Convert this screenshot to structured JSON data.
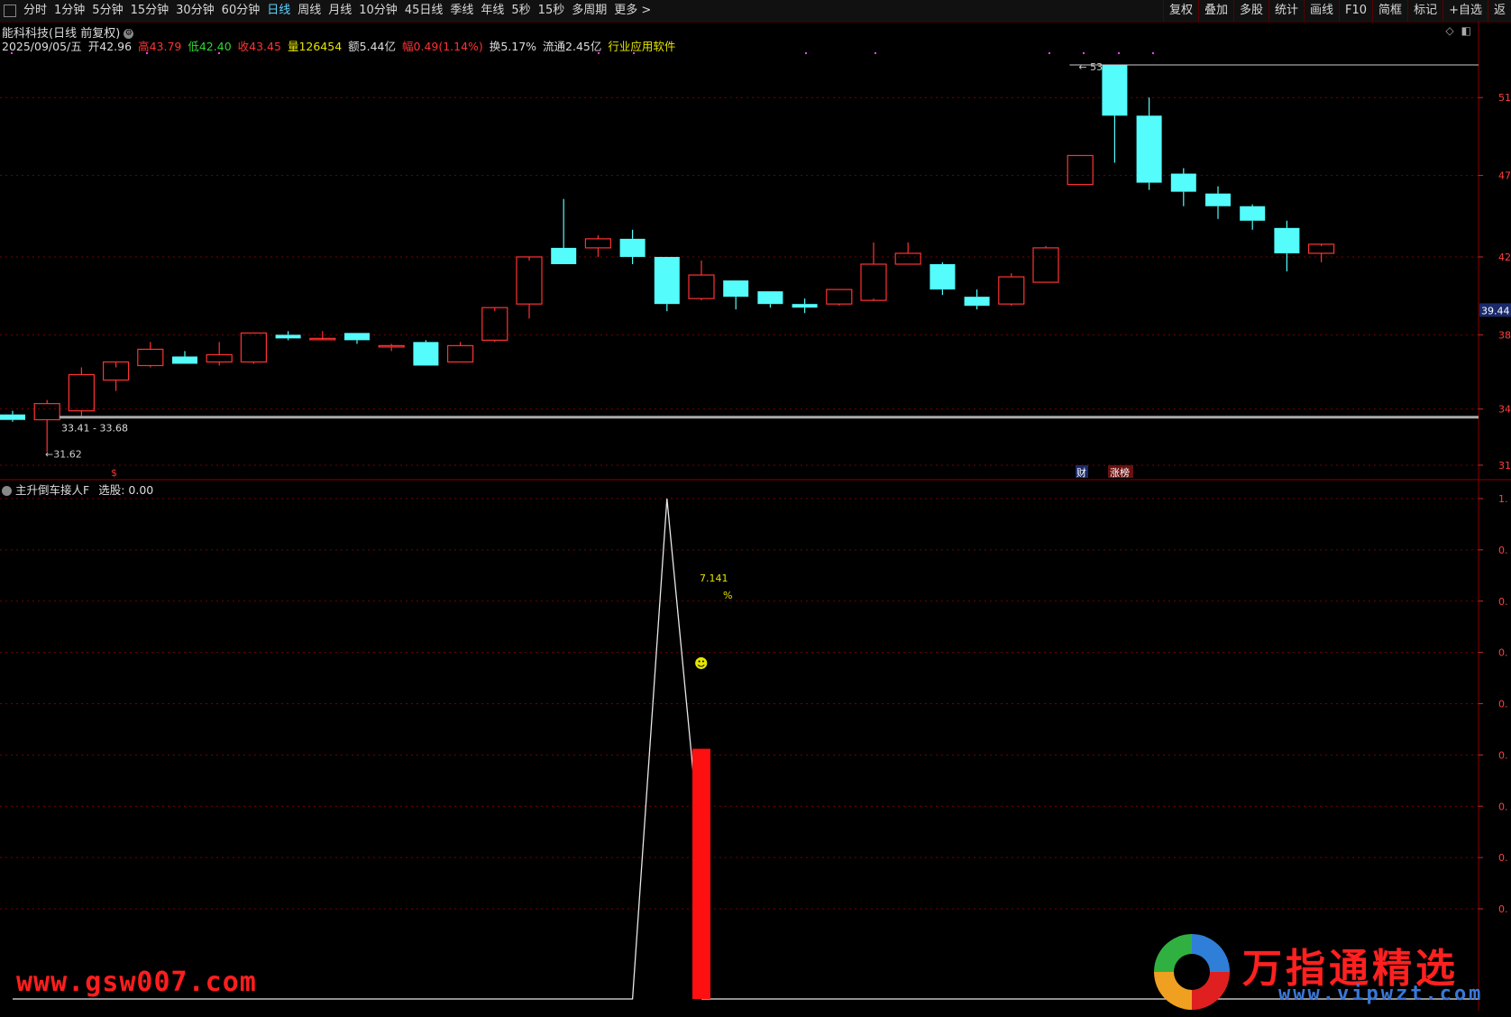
{
  "toolbar": {
    "periods": [
      "分时",
      "1分钟",
      "5分钟",
      "15分钟",
      "30分钟",
      "60分钟",
      "日线",
      "周线",
      "月线",
      "10分钟",
      "45日线",
      "季线",
      "年线",
      "5秒",
      "15秒",
      "多周期",
      "更多 >"
    ],
    "active_index": 6,
    "right_buttons": [
      "复权",
      "叠加",
      "多股",
      "统计",
      "画线",
      "F10",
      "简框",
      "标记",
      "+自选",
      "返"
    ]
  },
  "title": {
    "text": "能科科技(日线 前复权)"
  },
  "info": {
    "date": "2025/09/05/五",
    "open_label": "开",
    "open": "42.96",
    "high_label": "高",
    "high": "43.79",
    "low_label": "低",
    "low": "42.40",
    "close_label": "收",
    "close": "43.45",
    "vol_label": "量",
    "vol": "126454",
    "amount_label": "额",
    "amount": "5.44亿",
    "change_label": "幅",
    "change": "0.49(1.14%)",
    "turnover_label": "换",
    "turnover": "5.17%",
    "float_label": "流通",
    "float": "2.45亿",
    "industry": "行业应用软件"
  },
  "colors": {
    "up": "#ff3232",
    "down": "#54fcfc",
    "grid": "#7a0000",
    "price_tag_bg": "#1a2a6a"
  },
  "chart_data": [
    {
      "type": "candlestick",
      "axis_ticks": [
        "51.",
        "47.",
        "42.",
        "38.",
        "34.",
        "31."
      ],
      "current_price_tag": "39.44",
      "max_label": "53.",
      "min_label": "31.62",
      "range_label": "33.41 - 33.68",
      "marker_labels": [
        "$",
        "财",
        "涨榜"
      ],
      "candles": [
        {
          "o": 33.7,
          "h": 33.9,
          "l": 33.3,
          "c": 33.4
        },
        {
          "o": 33.41,
          "h": 34.5,
          "l": 31.62,
          "c": 34.3
        },
        {
          "o": 33.9,
          "h": 36.3,
          "l": 33.6,
          "c": 35.9
        },
        {
          "o": 35.6,
          "h": 36.3,
          "l": 35.0,
          "c": 36.6
        },
        {
          "o": 36.4,
          "h": 37.7,
          "l": 36.3,
          "c": 37.3
        },
        {
          "o": 36.9,
          "h": 37.2,
          "l": 36.5,
          "c": 36.5
        },
        {
          "o": 36.6,
          "h": 37.7,
          "l": 36.4,
          "c": 37.0
        },
        {
          "o": 36.6,
          "h": 38.2,
          "l": 36.5,
          "c": 38.2
        },
        {
          "o": 38.1,
          "h": 38.3,
          "l": 37.8,
          "c": 37.9
        },
        {
          "o": 37.9,
          "h": 38.3,
          "l": 37.9,
          "c": 37.9
        },
        {
          "o": 38.2,
          "h": 38.2,
          "l": 37.6,
          "c": 37.8
        },
        {
          "o": 37.5,
          "h": 37.6,
          "l": 37.2,
          "c": 37.5
        },
        {
          "o": 37.7,
          "h": 37.8,
          "l": 36.5,
          "c": 36.4
        },
        {
          "o": 36.6,
          "h": 37.7,
          "l": 36.6,
          "c": 37.5
        },
        {
          "o": 37.8,
          "h": 39.4,
          "l": 37.7,
          "c": 39.6
        },
        {
          "o": 39.8,
          "h": 42.2,
          "l": 39.0,
          "c": 42.4
        },
        {
          "o": 42.9,
          "h": 45.6,
          "l": 42.0,
          "c": 42.0
        },
        {
          "o": 42.9,
          "h": 43.6,
          "l": 42.4,
          "c": 43.4
        },
        {
          "o": 43.4,
          "h": 43.9,
          "l": 42.0,
          "c": 42.4
        },
        {
          "o": 42.4,
          "h": 42.4,
          "l": 39.4,
          "c": 39.8
        },
        {
          "o": 40.1,
          "h": 42.2,
          "l": 40.0,
          "c": 41.4
        },
        {
          "o": 41.1,
          "h": 41.1,
          "l": 39.5,
          "c": 40.2
        },
        {
          "o": 40.5,
          "h": 40.5,
          "l": 39.6,
          "c": 39.8
        },
        {
          "o": 39.8,
          "h": 40.1,
          "l": 39.3,
          "c": 39.6
        },
        {
          "o": 39.8,
          "h": 40.6,
          "l": 39.7,
          "c": 40.6
        },
        {
          "o": 40.0,
          "h": 43.2,
          "l": 40.1,
          "c": 42.0
        },
        {
          "o": 42.0,
          "h": 43.2,
          "l": 42.0,
          "c": 42.6
        },
        {
          "o": 42.0,
          "h": 42.1,
          "l": 40.3,
          "c": 40.6
        },
        {
          "o": 40.2,
          "h": 40.6,
          "l": 39.5,
          "c": 39.7
        },
        {
          "o": 39.8,
          "h": 41.5,
          "l": 39.7,
          "c": 41.3
        },
        {
          "o": 41.0,
          "h": 43.0,
          "l": 41.0,
          "c": 42.9
        },
        {
          "o": 46.4,
          "h": 48.0,
          "l": 46.4,
          "c": 48.0
        },
        {
          "o": 53.0,
          "h": 53.0,
          "l": 47.6,
          "c": 50.2
        },
        {
          "o": 50.2,
          "h": 51.2,
          "l": 46.1,
          "c": 46.5
        },
        {
          "o": 47.0,
          "h": 47.3,
          "l": 45.2,
          "c": 46.0
        },
        {
          "o": 45.9,
          "h": 46.3,
          "l": 44.5,
          "c": 45.2
        },
        {
          "o": 45.2,
          "h": 45.3,
          "l": 43.9,
          "c": 44.4
        },
        {
          "o": 44.0,
          "h": 44.4,
          "l": 41.6,
          "c": 42.6
        },
        {
          "o": 42.6,
          "h": 43.0,
          "l": 42.1,
          "c": 43.1
        }
      ]
    },
    {
      "type": "indicator",
      "title": "主升倒车接人F",
      "select_label": "选股:",
      "select_value": "0.00",
      "axis_ticks": [
        "1.",
        "0.",
        "0.",
        "0.",
        "0.",
        "0.",
        "0.",
        "0.",
        "0."
      ],
      "line_values": [
        0,
        0,
        0,
        0,
        0,
        0,
        0,
        0,
        0,
        0,
        0,
        0,
        0,
        0,
        0,
        0,
        0,
        0,
        0,
        1.0,
        0.28,
        null,
        null,
        null,
        null,
        null,
        null,
        null,
        null,
        null,
        null,
        null,
        null,
        null,
        null,
        null,
        null,
        null,
        null
      ],
      "bar": {
        "index": 20,
        "value": 0.5
      },
      "annotation_value": "7.141",
      "annotation_unit": "%",
      "smiley": "☻"
    }
  ],
  "watermarks": {
    "left": "www.gsw007.com",
    "right": "万指通精选",
    "right_url": "www.vipwzt.com"
  }
}
